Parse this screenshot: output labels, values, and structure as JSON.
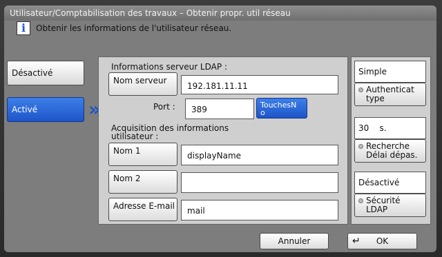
{
  "window": {
    "title": "Utilisateur/Comptabilisation des travaux – Obtenir propr. util réseau"
  },
  "info": {
    "icon": "info-icon",
    "glyph": "i",
    "message": "Obtenir les informations de l'utilisateur réseau."
  },
  "toggle": {
    "off_label": "Désactivé",
    "on_label": "Activé",
    "selected": "Activé",
    "selected_color": "#2a65d8"
  },
  "ldap": {
    "section_label": "Informations serveur LDAP :",
    "server_button": "Nom serveur",
    "server_value": "192.181.11.11",
    "port_label": "Port :",
    "port_value": "389",
    "keys_button": "TouchesN\no"
  },
  "acquisition": {
    "section_label": "Acquisition des informations\nutilisateur :",
    "name1_button": "Nom 1",
    "name1_value": "displayName",
    "name2_button": "Nom 2",
    "name2_value": "",
    "email_button": "Adresse E-mail",
    "email_value": "mail"
  },
  "right": {
    "auth_value": "Simple",
    "auth_button": "Authenticat\ntype",
    "timeout_value": "30",
    "timeout_unit": "s.",
    "timeout_button": "Recherche\nDélai dépas.",
    "security_value": "Désactivé",
    "security_button": "Sécurité\nLDAP"
  },
  "footer": {
    "cancel": "Annuler",
    "ok": "OK",
    "ok_icon": "enter-icon"
  }
}
